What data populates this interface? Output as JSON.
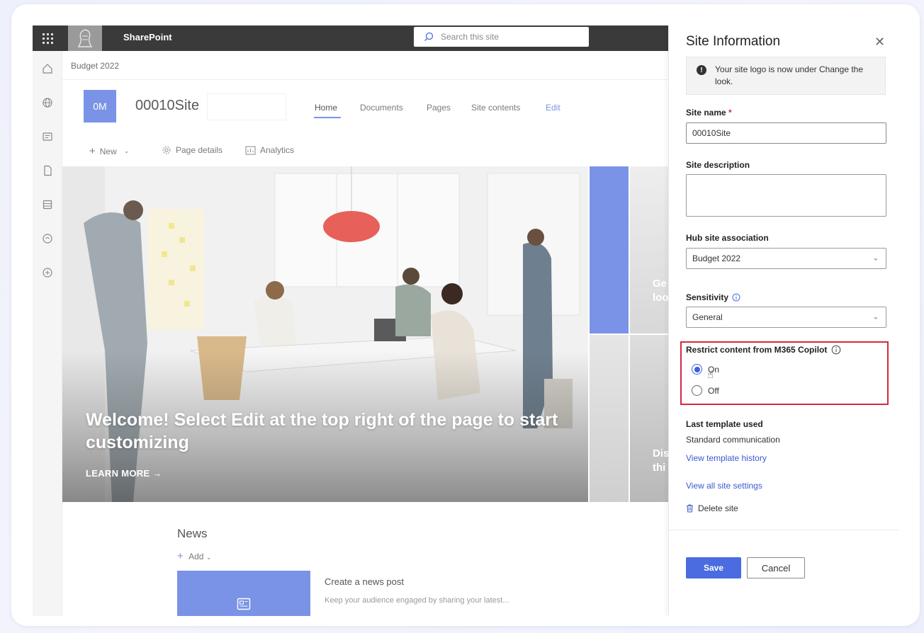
{
  "app": {
    "name": "SharePoint"
  },
  "search": {
    "placeholder": "Search this site"
  },
  "page": {
    "breadcrumb": "Budget 2022",
    "site_tile": "0M",
    "site_title": "00010Site",
    "nav": [
      {
        "label": "Home"
      },
      {
        "label": "Documents"
      },
      {
        "label": "Pages"
      },
      {
        "label": "Site contents"
      },
      {
        "label": "Edit"
      }
    ],
    "commands": {
      "new_label": "New",
      "page_details_label": "Page details",
      "analytics_label": "Analytics"
    },
    "hero": {
      "title": "Welcome! Select Edit at the top right of the page to start customizing",
      "learn_more": "LEARN MORE →",
      "tile1_text": "Ge\nloo",
      "tile2_text": "Dis\nthi"
    },
    "news": {
      "title": "News",
      "add_label": "Add",
      "post_title": "Create a news post",
      "post_sub": "Keep your audience engaged by sharing your latest..."
    }
  },
  "panel": {
    "title": "Site Information",
    "info_message": "Your site logo is now under Change the look.",
    "site_name_label": "Site name",
    "site_name_value": "00010Site",
    "site_description_label": "Site description",
    "site_description_value": "",
    "hub_label": "Hub site association",
    "hub_value": "Budget 2022",
    "sensitivity_label": "Sensitivity",
    "sensitivity_value": "General",
    "restrict_label": "Restrict content from M365 Copilot",
    "restrict_options": [
      {
        "label": "On",
        "selected": true
      },
      {
        "label": "Off",
        "selected": false
      }
    ],
    "last_template_label": "Last template used",
    "last_template_value": "Standard communication",
    "view_history_link": "View template history",
    "view_settings_link": "View all site settings",
    "delete_site": "Delete site",
    "save_label": "Save",
    "cancel_label": "Cancel"
  },
  "colors": {
    "accent": "#7b93e6",
    "primary_button": "#4a6ce0",
    "highlight_box": "#d6283f",
    "topbar": "#3a3a3a"
  }
}
